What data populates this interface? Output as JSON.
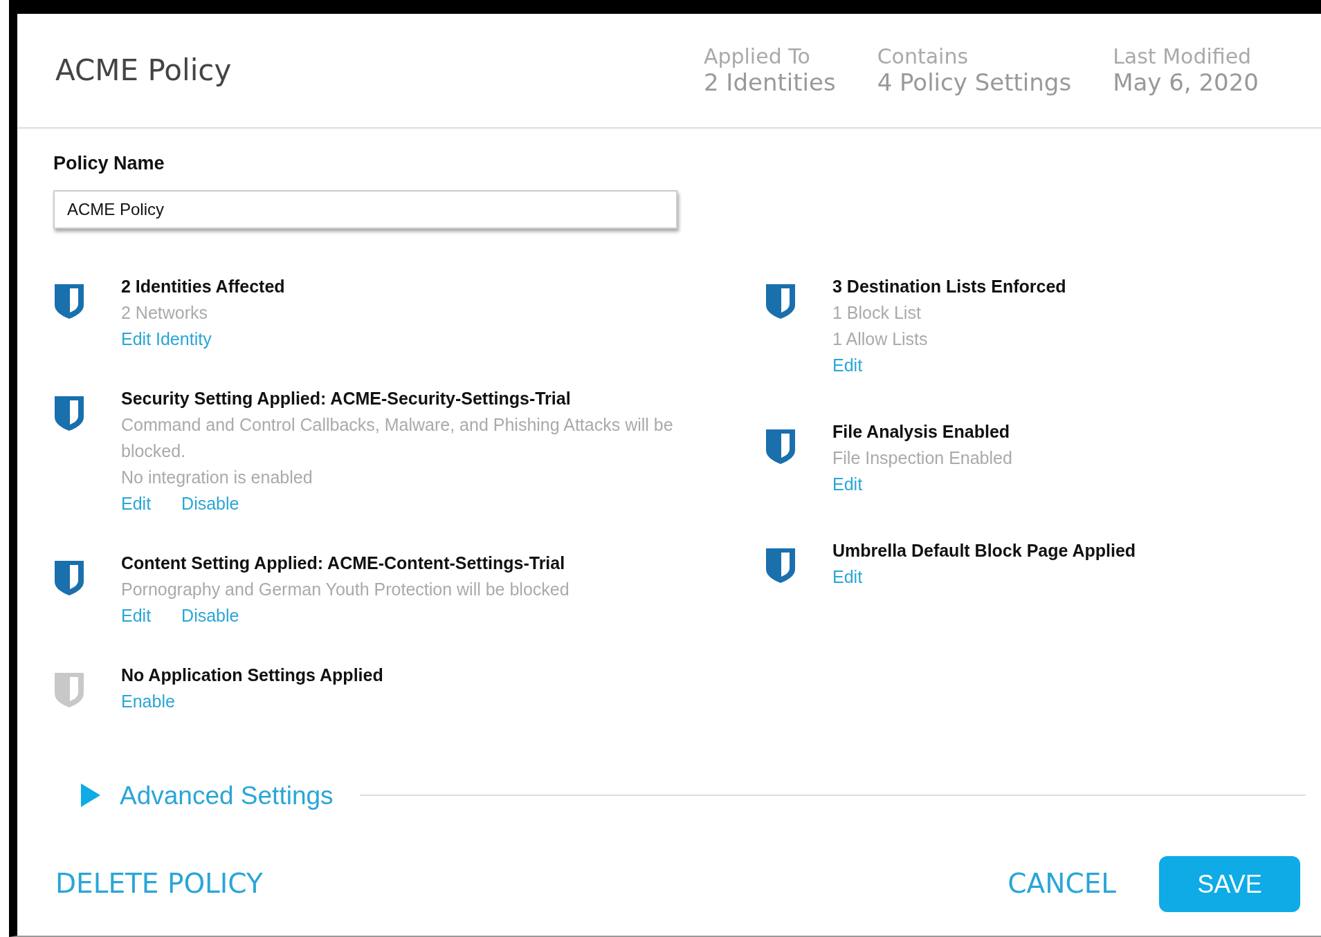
{
  "header": {
    "title": "ACME Policy",
    "stats": [
      {
        "label": "Applied To",
        "value": "2 Identities"
      },
      {
        "label": "Contains",
        "value": "4 Policy Settings"
      },
      {
        "label": "Last Modified",
        "value": "May 6, 2020"
      }
    ]
  },
  "policy_name": {
    "label": "Policy Name",
    "value": "ACME Policy"
  },
  "columns": [
    {
      "items": [
        {
          "enabled": true,
          "title": "2 Identities Affected",
          "details": [
            "2 Networks"
          ],
          "links": [
            "Edit Identity"
          ]
        },
        {
          "enabled": true,
          "title": "Security Setting Applied: ACME-Security-Settings-Trial",
          "details": [
            "Command  and Control Callbacks, Malware, and Phishing Attacks will be blocked.",
            "No integration is enabled"
          ],
          "links": [
            "Edit",
            "Disable"
          ]
        },
        {
          "enabled": true,
          "title": "Content Setting Applied: ACME-Content-Settings-Trial",
          "details": [
            "Pornography and German  Youth Protection  will be blocked"
          ],
          "links": [
            "Edit",
            "Disable"
          ]
        },
        {
          "enabled": false,
          "title": "No Application Settings Applied",
          "links": [
            "Enable"
          ]
        }
      ]
    },
    {
      "items": [
        {
          "enabled": true,
          "title": "3 Destination Lists Enforced",
          "details": [
            "1 Block List",
            "1 Allow Lists"
          ],
          "links": [
            "Edit"
          ]
        },
        {
          "enabled": true,
          "title": "File Analysis Enabled",
          "details": [
            "File Inspection  Enabled"
          ],
          "links": [
            "Edit"
          ]
        },
        {
          "enabled": true,
          "title": "Umbrella Default Block Page Applied",
          "links": [
            "Edit"
          ]
        }
      ]
    }
  ],
  "advanced": {
    "label": "Advanced Settings",
    "expanded": false
  },
  "footer": {
    "delete": "DELETE POLICY",
    "cancel": "CANCEL",
    "save": "SAVE"
  }
}
